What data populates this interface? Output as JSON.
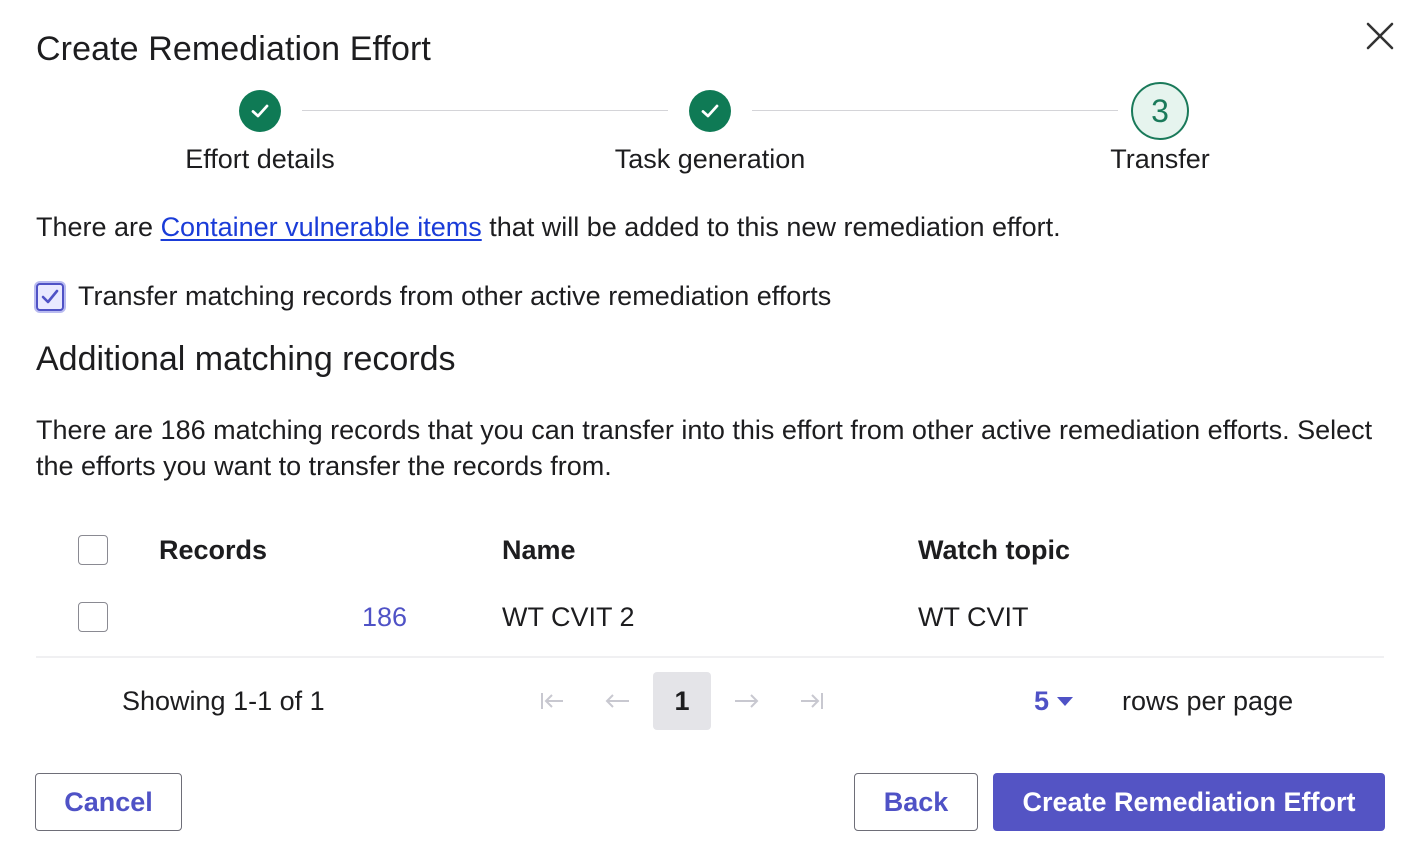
{
  "dialog": {
    "title": "Create Remediation Effort",
    "close_icon": "close-icon"
  },
  "stepper": {
    "steps": [
      {
        "label": "Effort details",
        "status": "complete",
        "icon": "check-icon"
      },
      {
        "label": "Task generation",
        "status": "complete",
        "icon": "check-icon"
      },
      {
        "label": "Transfer",
        "status": "current",
        "number": "3"
      }
    ],
    "complete_color": "#0f7a55"
  },
  "intro": {
    "prefix": "There are ",
    "link": "Container vulnerable items",
    "suffix": " that will be added to this new remediation effort."
  },
  "transfer_option": {
    "checked": true,
    "label": "Transfer matching records from other active remediation efforts"
  },
  "section": {
    "heading": "Additional matching records",
    "description": "There are 186 matching records that you can transfer into this effort from other active remediation efforts. Select the efforts you want to transfer the records from."
  },
  "table": {
    "columns": [
      "Records",
      "Name",
      "Watch topic"
    ],
    "rows": [
      {
        "records": "186",
        "name": "WT CVIT 2",
        "watch_topic": "WT CVIT",
        "selected": false
      }
    ]
  },
  "pagination": {
    "showing": "Showing 1-1 of 1",
    "current_page": "1",
    "rows_per_page_value": "5",
    "rows_per_page_label": "rows per page",
    "icons": [
      "first-page-icon",
      "prev-page-icon",
      "next-page-icon",
      "last-page-icon"
    ]
  },
  "footer": {
    "cancel_label": "Cancel",
    "back_label": "Back",
    "create_label": "Create Remediation Effort"
  },
  "colors": {
    "primary": "#5454c4",
    "link": "#1a3cd8",
    "success": "#0f7a55"
  }
}
